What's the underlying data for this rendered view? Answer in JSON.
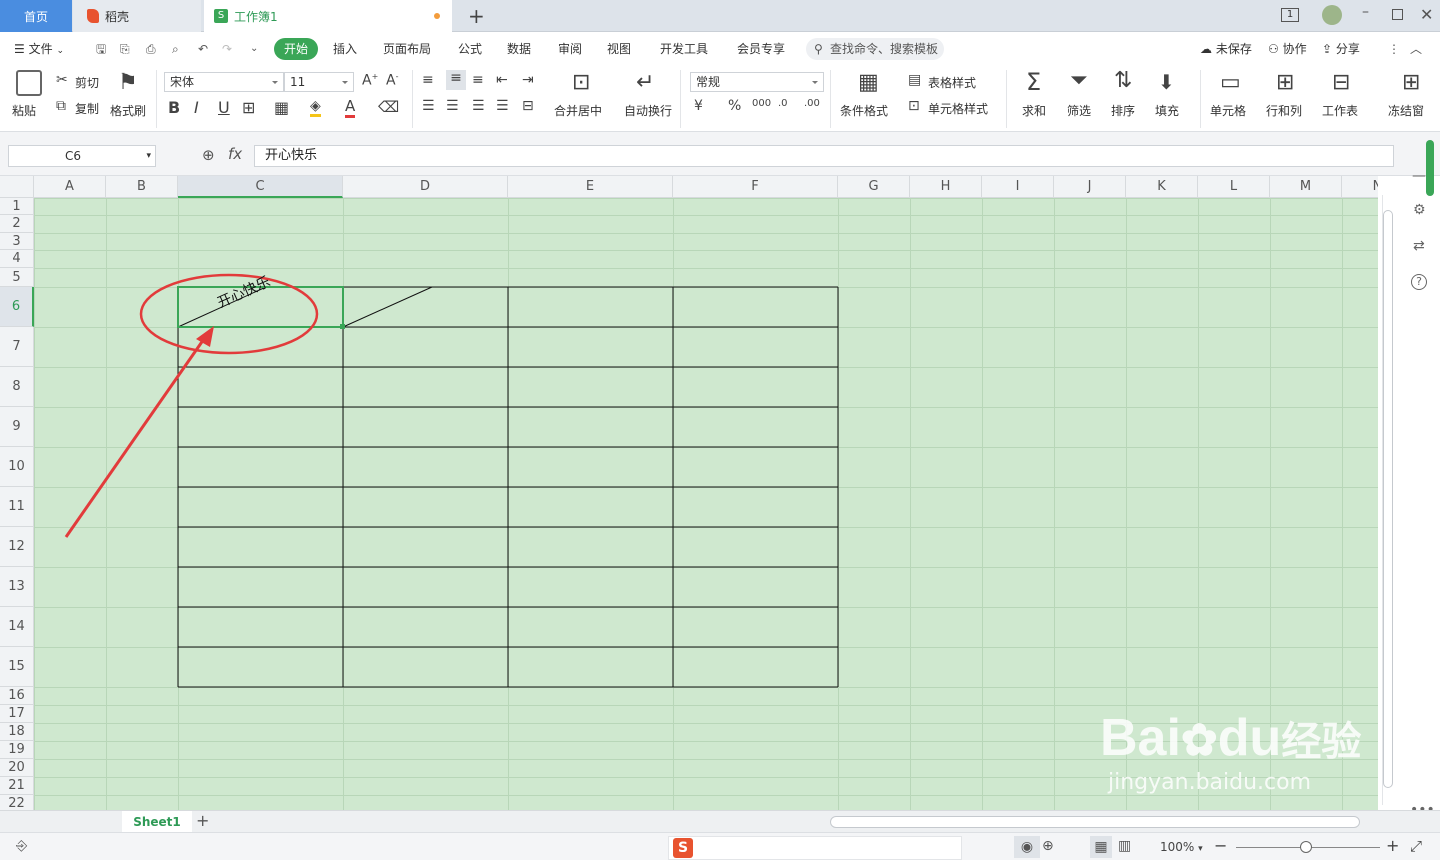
{
  "tabs": {
    "home": "首页",
    "daoke": "稻壳",
    "book": "工作簿1",
    "new_tab": "+"
  },
  "window": {
    "badge": "1"
  },
  "menu": {
    "file": "文件",
    "items": [
      "开始",
      "插入",
      "页面布局",
      "公式",
      "数据",
      "审阅",
      "视图",
      "开发工具",
      "会员专享"
    ],
    "search_placeholder": "查找命令、搜索模板",
    "unsaved": "未保存",
    "collab": "协作",
    "share": "分享"
  },
  "ribbon": {
    "paste": "粘贴",
    "cut": "剪切",
    "copy": "复制",
    "format_painter": "格式刷",
    "font_name": "宋体",
    "font_size": "11",
    "merge_center": "合并居中",
    "wrap_text": "自动换行",
    "number_format": "常规",
    "conditional_format": "条件格式",
    "table_style": "表格样式",
    "cell_style": "单元格样式",
    "sum": "求和",
    "filter": "筛选",
    "sort": "排序",
    "fill": "填充",
    "cell": "单元格",
    "row_col": "行和列",
    "worksheet": "工作表",
    "freeze": "冻结窗"
  },
  "formula_bar": {
    "cell_ref": "C6",
    "fx": "fx",
    "content": "开心快乐"
  },
  "columns": [
    "A",
    "B",
    "C",
    "D",
    "E",
    "F",
    "G",
    "H",
    "I",
    "J",
    "K",
    "L",
    "M",
    "N"
  ],
  "rows": [
    "1",
    "2",
    "3",
    "4",
    "5",
    "6",
    "7",
    "8",
    "9",
    "10",
    "11",
    "12",
    "13",
    "14",
    "15",
    "16",
    "17",
    "18",
    "19",
    "20",
    "21",
    "22"
  ],
  "cell_c6_text": "开心快乐",
  "sheets": {
    "sheet1": "Sheet1",
    "add": "+"
  },
  "status": {
    "zoom": "100%"
  },
  "watermark": {
    "line1": "Bai",
    "line2": "du",
    "line3": "经验",
    "url": "jingyan.baidu.com"
  },
  "colors": {
    "accent": "#3aa657",
    "sheet_bg": "#cfe8cf",
    "annotation": "#e23b3b",
    "tab_active": "#4a8de0"
  }
}
